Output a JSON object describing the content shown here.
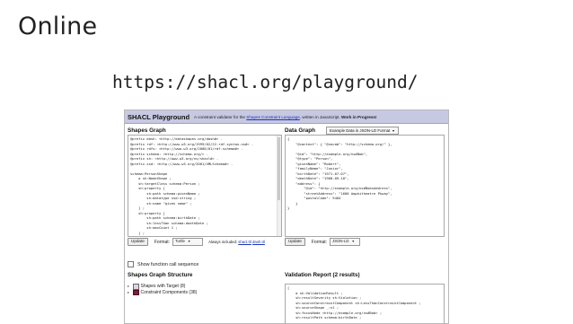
{
  "slide": {
    "title": "Online",
    "url": "https://shacl.org/playground/"
  },
  "app": {
    "title": "SHACL Playground",
    "tagline_pre": "A constraint validator for the ",
    "tagline_link": "Shapes Constraint Language",
    "tagline_mid": ", written in JavaScript. ",
    "tagline_bold": "Work in Progress!"
  },
  "shapes_graph": {
    "heading": "Shapes Graph",
    "lines": [
      "@prefix dash: <http://datashapes.org/dash#> .",
      "@prefix rdf: <http://www.w3.org/1999/02/22-rdf-syntax-ns#> .",
      "@prefix rdfs: <http://www.w3.org/2000/01/rdf-schema#> .",
      "@prefix schema: <http://schema.org/> .",
      "@prefix sh: <http://www.w3.org/ns/shacl#> .",
      "@prefix xsd: <http://www.w3.org/2001/XMLSchema#> .",
      "",
      "schema:PersonShape",
      "    a sh:NodeShape ;",
      "    sh:targetClass schema:Person ;",
      "    sh:property [",
      "        sh:path schema:givenName ;",
      "        sh:datatype xsd:string ;",
      "        sh:name \"given name\" ;",
      "    ] ;",
      "    sh:property [",
      "        sh:path schema:birthDate ;",
      "        sh:lessThan schema:deathDate ;",
      "        sh:maxCount 1 ;",
      "    ] ;",
      "    sh:property [",
      "        sh:path schema:gender ;",
      "        sh:in ( \"female\" \"male\" ) ;",
      "    ] ;",
      "    sh:property ["
    ],
    "update_label": "Update",
    "format_label": "Format:",
    "format_value": "Turtle",
    "always_label": "Always included: ",
    "always_link1": "shacl.ttl",
    "always_link2": "dash.ttl"
  },
  "data_graph": {
    "heading": "Data Graph",
    "example_select": "Example Data in JSON-LD Format",
    "lines": [
      "{",
      "    \"@context\": { \"@vocab\": \"http://schema.org/\" },",
      "",
      "    \"@id\": \"http://example.org/ns#Bob\",",
      "    \"@type\": \"Person\",",
      "    \"givenName\": \"Robert\",",
      "    \"familyName\": \"Junior\",",
      "    \"birthDate\": \"1971-07-07\",",
      "    \"deathDate\": \"1968-09-10\",",
      "    \"address\": {",
      "        \"@id\": \"http://example.org/ns#BobsAddress\",",
      "        \"streetAddress\": \"1600 Amphitheatre Pkway\",",
      "        \"postalCode\": 9404",
      "    }",
      "}"
    ],
    "update_label": "Update",
    "format_label": "Format:",
    "format_value": "JSON-LD"
  },
  "options": {
    "show_function_calls": "Show function call sequence"
  },
  "structure": {
    "heading": "Shapes Graph Structure",
    "items": [
      "Shapes with Target (8)",
      "Constraint Components (38)"
    ]
  },
  "report": {
    "heading": "Validation Report (2 results)",
    "lines": [
      "[",
      "    a sh:ValidationResult ;",
      "    sh:resultSeverity sh:Violation ;",
      "    sh:sourceConstraintComponent sh:LessThanConstraintComponent ;",
      "    sh:sourceShape _:n1 ;",
      "    sh:focusNode <http://example.org/ns#Bob> ;",
      "    sh:resultPath schema:birthDate ;"
    ]
  }
}
